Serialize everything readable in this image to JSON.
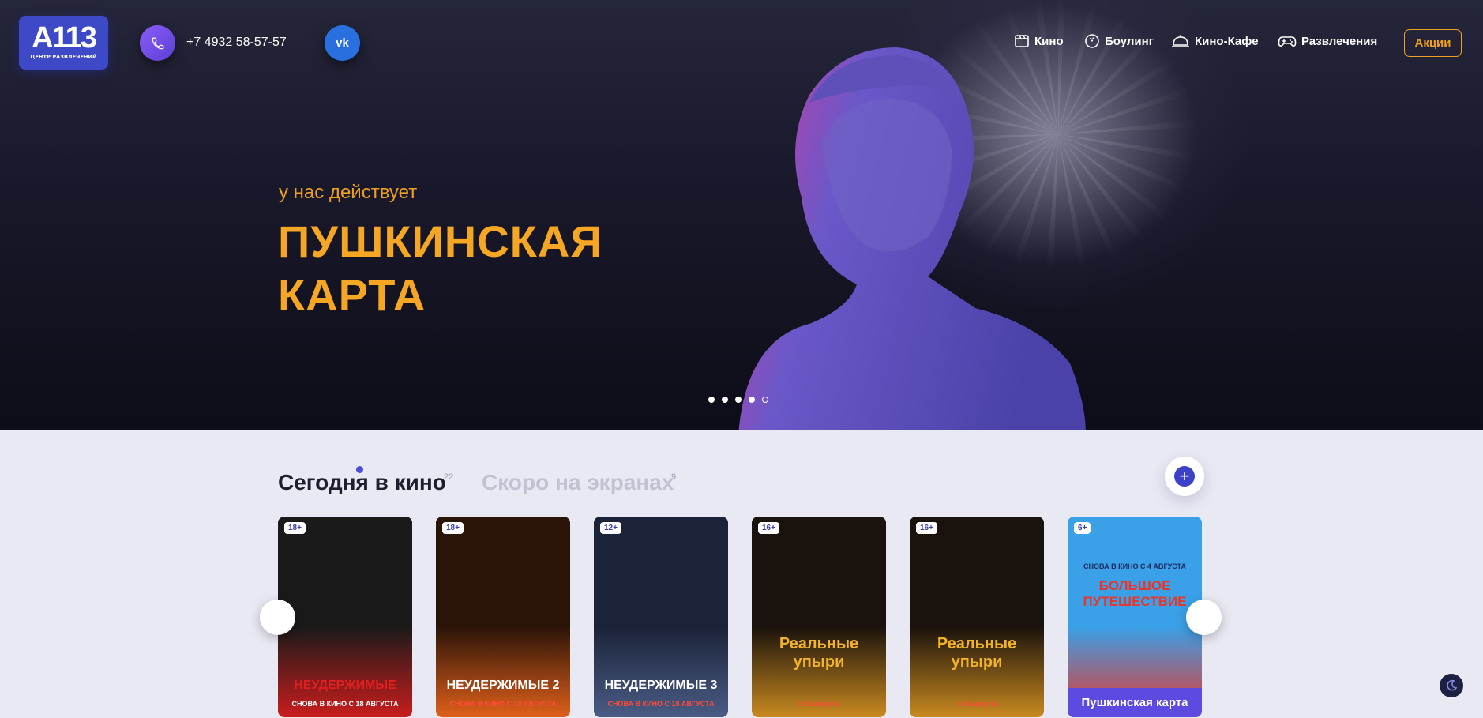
{
  "header": {
    "logo_main": "А113",
    "logo_sub": "ЦЕНТР РАЗВЛЕЧЕНИЙ",
    "phone": "+7 4932 58-57-57",
    "vk_label": "vk",
    "nav": [
      {
        "label": "Кино",
        "icon": "film-icon"
      },
      {
        "label": "Боулинг",
        "icon": "bowling-ball-icon"
      },
      {
        "label": "Кино-Кафе",
        "icon": "cloche-icon"
      },
      {
        "label": "Развлечения",
        "icon": "gamepad-icon"
      }
    ],
    "promo_label": "Акции"
  },
  "hero": {
    "subtitle": "у нас действует",
    "title": "ПУШКИНСКАЯ КАРТА",
    "slides_total": 5,
    "slide_active": 5
  },
  "tabs": {
    "now_label": "Сегодня в кино",
    "now_count": "22",
    "soon_label": "Скоро на экранах",
    "soon_count": "9"
  },
  "movies": [
    {
      "age": "18+",
      "poster_title": "НЕУДЕРЖИМЫЕ",
      "poster_line": "СНОВА В КИНО С 18 АВГУСТА",
      "colors": [
        "#1a1a1a",
        "#c91d1d"
      ]
    },
    {
      "age": "18+",
      "poster_title": "НЕУДЕРЖИМЫЕ 2",
      "poster_line": "СНОВА В КИНО С 18 АВГУСТА",
      "colors": [
        "#2a1408",
        "#e0601a"
      ]
    },
    {
      "age": "12+",
      "poster_title": "НЕУДЕРЖИМЫЕ 3",
      "poster_line": "СНОВА В КИНО С 18 АВГУСТА",
      "colors": [
        "#1b2338",
        "#4a5c85"
      ]
    },
    {
      "age": "16+",
      "poster_title": "Реальные упыри",
      "poster_line": "с 18 августа",
      "colors": [
        "#1a120c",
        "#c98a20"
      ]
    },
    {
      "age": "16+",
      "poster_title": "Реальные упыри",
      "poster_line": "с 18 августа",
      "colors": [
        "#1a120c",
        "#c98a20"
      ]
    },
    {
      "age": "6+",
      "poster_title": "БОЛЬШОЕ ПУТЕШЕСТВИЕ",
      "poster_line": "СНОВА В КИНО С 4 АВГУСТА",
      "tag": "Пушкинская карта",
      "colors": [
        "#3aa0e8",
        "#e8362a"
      ]
    }
  ]
}
